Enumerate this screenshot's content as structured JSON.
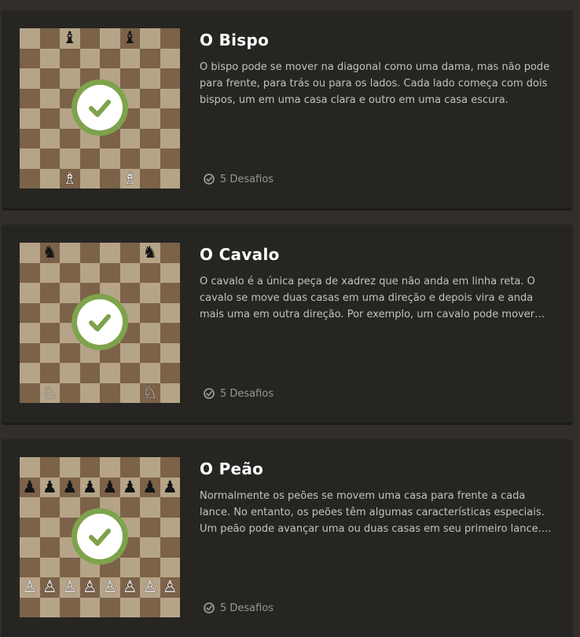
{
  "lessons": [
    {
      "title": "O Bispo",
      "description": "O bispo pode se mover na diagonal como uma dama, mas não pode para frente, para trás ou para os lados. Cada lado começa com dois bispos, um em uma casa clara e outro em uma casa escura.",
      "challenges_label": "5 Desafios",
      "completed": true,
      "pieces": [
        {
          "square": "c8",
          "glyph": "♝",
          "color": "black"
        },
        {
          "square": "f8",
          "glyph": "♝",
          "color": "black"
        },
        {
          "square": "c1",
          "glyph": "♗",
          "color": "white"
        },
        {
          "square": "f1",
          "glyph": "♗",
          "color": "white"
        }
      ]
    },
    {
      "title": "O Cavalo",
      "description": "O cavalo é a única peça de xadrez que não anda em linha reta. O cavalo se move duas casas em uma direção e depois vira e anda mais uma em outra direção. Por exemplo, um cavalo pode mover duas casas para cima e uma para a direita.",
      "challenges_label": "5 Desafios",
      "completed": true,
      "pieces": [
        {
          "square": "b8",
          "glyph": "♞",
          "color": "black"
        },
        {
          "square": "g8",
          "glyph": "♞",
          "color": "black"
        },
        {
          "square": "b1",
          "glyph": "♘",
          "color": "white"
        },
        {
          "square": "g1",
          "glyph": "♘",
          "color": "white"
        }
      ]
    },
    {
      "title": "O Peão",
      "description": "Normalmente os peões se movem uma casa para frente a cada lance. No entanto, os peões têm algumas características especiais. Um peão pode avançar uma ou duas casas em seu primeiro lance. Além disso, os peões capturam na diagonal.",
      "challenges_label": "5 Desafios",
      "completed": true,
      "pieces": [
        {
          "square": "a7",
          "glyph": "♟",
          "color": "black"
        },
        {
          "square": "b7",
          "glyph": "♟",
          "color": "black"
        },
        {
          "square": "c7",
          "glyph": "♟",
          "color": "black"
        },
        {
          "square": "d7",
          "glyph": "♟",
          "color": "black"
        },
        {
          "square": "e7",
          "glyph": "♟",
          "color": "black"
        },
        {
          "square": "f7",
          "glyph": "♟",
          "color": "black"
        },
        {
          "square": "g7",
          "glyph": "♟",
          "color": "black"
        },
        {
          "square": "h7",
          "glyph": "♟",
          "color": "black"
        },
        {
          "square": "a2",
          "glyph": "♙",
          "color": "white"
        },
        {
          "square": "b2",
          "glyph": "♙",
          "color": "white"
        },
        {
          "square": "c2",
          "glyph": "♙",
          "color": "white"
        },
        {
          "square": "d2",
          "glyph": "♙",
          "color": "white"
        },
        {
          "square": "e2",
          "glyph": "♙",
          "color": "white"
        },
        {
          "square": "f2",
          "glyph": "♙",
          "color": "white"
        },
        {
          "square": "g2",
          "glyph": "♙",
          "color": "white"
        },
        {
          "square": "h2",
          "glyph": "♙",
          "color": "white"
        }
      ]
    }
  ],
  "icons": {
    "completed": "checkmark-icon",
    "challenges": "check-circle-icon"
  },
  "colors": {
    "background": "#312e2b",
    "card": "#262522",
    "board_light": "#b6a488",
    "board_dark": "#7b6249",
    "check_green": "#7ea34c"
  }
}
